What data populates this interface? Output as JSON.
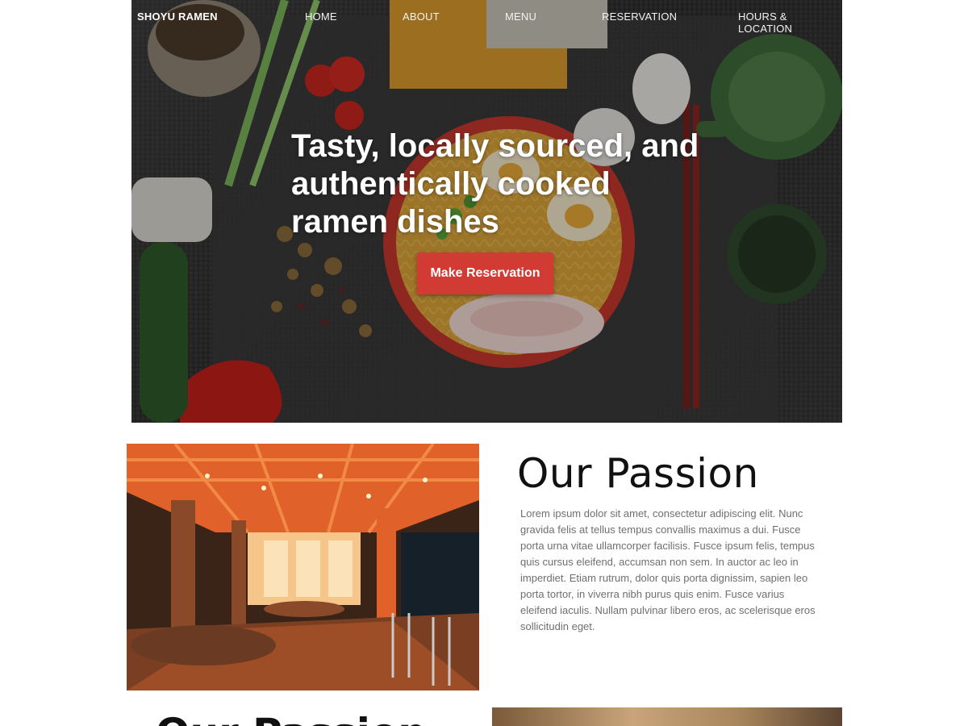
{
  "nav": {
    "brand": "SHOYU RAMEN",
    "links": [
      "HOME",
      "ABOUT",
      "MENU",
      "RESERVATION",
      "HOURS & LOCATION"
    ]
  },
  "hero": {
    "headline": "Tasty, locally sourced, and authentically cooked ramen dishes",
    "cta_label": "Make Reservation",
    "cta_color": "#d23b33"
  },
  "passion": {
    "title": "Our Passion",
    "body": "Lorem ipsum dolor sit amet, consectetur adipiscing elit. Nunc gravida felis at tellus tempus convallis maximus a dui. Fusce porta urna vitae ullamcorper facilisis. Fusce ipsum felis, tempus quis cursus eleifend, accumsan non sem. In auctor ac leo in imperdiet. Etiam rutrum, dolor quis porta dignissim, sapien leo porta tortor, in viverra nibh purus quis enim. Fusce varius eleifend iaculis. Nullam pulvinar libero eros, ac scelerisque eros sollicitudin eget."
  },
  "next_section": {
    "title": "Our Passion"
  }
}
